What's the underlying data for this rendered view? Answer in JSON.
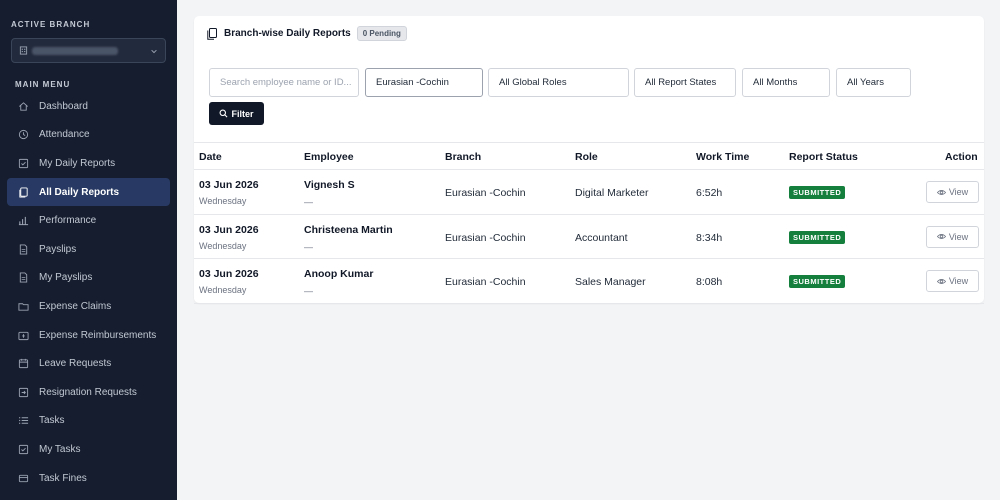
{
  "sidebar": {
    "active_branch_label": "ACTIVE BRANCH",
    "main_menu_label": "MAIN MENU",
    "items": [
      {
        "label": "Dashboard",
        "icon": "home-icon"
      },
      {
        "label": "Attendance",
        "icon": "clock-icon"
      },
      {
        "label": "My Daily Reports",
        "icon": "check-square-icon"
      },
      {
        "label": "All Daily Reports",
        "icon": "copy-icon",
        "active": true
      },
      {
        "label": "Performance",
        "icon": "bar-chart-icon"
      },
      {
        "label": "Payslips",
        "icon": "file-icon"
      },
      {
        "label": "My Payslips",
        "icon": "file-icon"
      },
      {
        "label": "Expense Claims",
        "icon": "folder-icon"
      },
      {
        "label": "Expense Reimbursements",
        "icon": "wallet-icon"
      },
      {
        "label": "Leave Requests",
        "icon": "calendar-icon"
      },
      {
        "label": "Resignation Requests",
        "icon": "door-icon"
      },
      {
        "label": "Tasks",
        "icon": "list-icon"
      },
      {
        "label": "My Tasks",
        "icon": "check-box-icon"
      },
      {
        "label": "Task Fines",
        "icon": "tag-icon"
      }
    ]
  },
  "header": {
    "title": "Branch-wise Daily Reports",
    "pending_badge": "0 Pending"
  },
  "filters": {
    "search_placeholder": "Search employee name or ID...",
    "branch": "Eurasian -Cochin",
    "roles": "All Global Roles",
    "report_states": "All Report States",
    "months": "All Months",
    "years": "All Years",
    "filter_button": "Filter"
  },
  "table": {
    "headers": {
      "date": "Date",
      "employee": "Employee",
      "branch": "Branch",
      "role": "Role",
      "work_time": "Work Time",
      "report_status": "Report Status",
      "action": "Action"
    },
    "rows": [
      {
        "date": "03 Jun 2026",
        "day": "Wednesday",
        "employee": "Vignesh S",
        "sub": "—",
        "branch": "Eurasian -Cochin",
        "role": "Digital Marketer",
        "work_time": "6:52h",
        "status": "SUBMITTED",
        "action": "View"
      },
      {
        "date": "03 Jun 2026",
        "day": "Wednesday",
        "employee": "Christeena Martin",
        "sub": "—",
        "branch": "Eurasian -Cochin",
        "role": "Accountant",
        "work_time": "8:34h",
        "status": "SUBMITTED",
        "action": "View"
      },
      {
        "date": "03 Jun 2026",
        "day": "Wednesday",
        "employee": "Anoop Kumar",
        "sub": "—",
        "branch": "Eurasian -Cochin",
        "role": "Sales Manager",
        "work_time": "8:08h",
        "status": "SUBMITTED",
        "action": "View"
      }
    ]
  },
  "colors": {
    "sidebar_bg": "#161d2e",
    "active_item_bg": "#283a63",
    "status_green": "#15803d",
    "filter_button_bg": "#111827"
  }
}
